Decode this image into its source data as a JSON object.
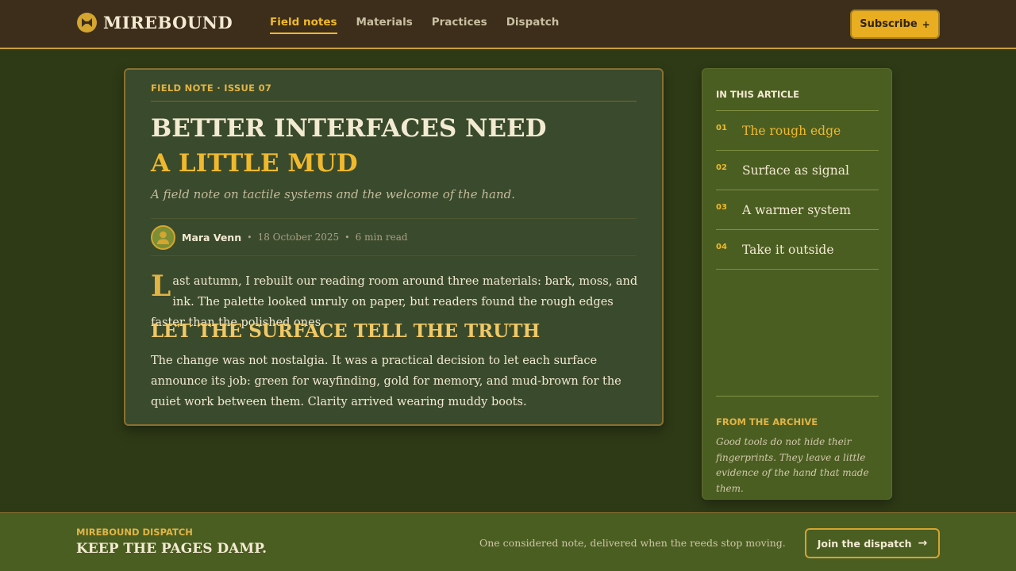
{
  "header": {
    "brand": "Mirebound",
    "nav": [
      {
        "label": "Field notes",
        "active": true
      },
      {
        "label": "Materials",
        "active": false
      },
      {
        "label": "Practices",
        "active": false
      },
      {
        "label": "Dispatch",
        "active": false
      }
    ],
    "subscribe_label": "Subscribe",
    "subscribe_icon": "+"
  },
  "article": {
    "eyebrow": "FIELD NOTE · ISSUE 07",
    "headline_line1": "Better interfaces need",
    "headline_line2": "a little mud",
    "dek": "A field note on tactile systems and the welcome of the hand.",
    "author": "Mara Venn",
    "date": "18 October 2025",
    "read_time": "6 min read",
    "lede_dropcap": "L",
    "lede_rest": "ast autumn, I rebuilt our reading room around three materials: bark, moss, and ink. The palette looked unruly on paper, but readers found the rough edges faster than the polished ones.",
    "subhead": "Let the surface tell the truth",
    "body": "The change was not nostalgia. It was a practical decision to let each surface announce its job: green for wayfinding, gold for memory, and mud-brown for the quiet work between them. Clarity arrived wearing muddy boots."
  },
  "sidebar": {
    "title": "IN THIS ARTICLE",
    "items": [
      {
        "num": "01",
        "label": "The rough edge"
      },
      {
        "num": "02",
        "label": "Surface as signal"
      },
      {
        "num": "03",
        "label": "A warmer system"
      },
      {
        "num": "04",
        "label": "Take it outside"
      }
    ],
    "archive_title": "FROM THE ARCHIVE",
    "archive_quote": "Good tools do not hide their fingerprints. They leave a little evidence of the hand that made them."
  },
  "footer": {
    "eyebrow": "MIREBOUND DISPATCH",
    "title": "Keep the pages damp.",
    "tagline": "One considered note, delivered when the reeds stop moving.",
    "join_label": "Join the dispatch",
    "join_icon": "→"
  },
  "colors": {
    "accent": "#f0b92d",
    "topbar": "#3c2e1a",
    "background": "#2e3a16",
    "card": "#3a4a2c",
    "sidebar": "#4b5e22"
  },
  "icons": [
    "brand-logo-icon",
    "plus-icon",
    "author-avatar-icon",
    "arrow-right-icon"
  ]
}
